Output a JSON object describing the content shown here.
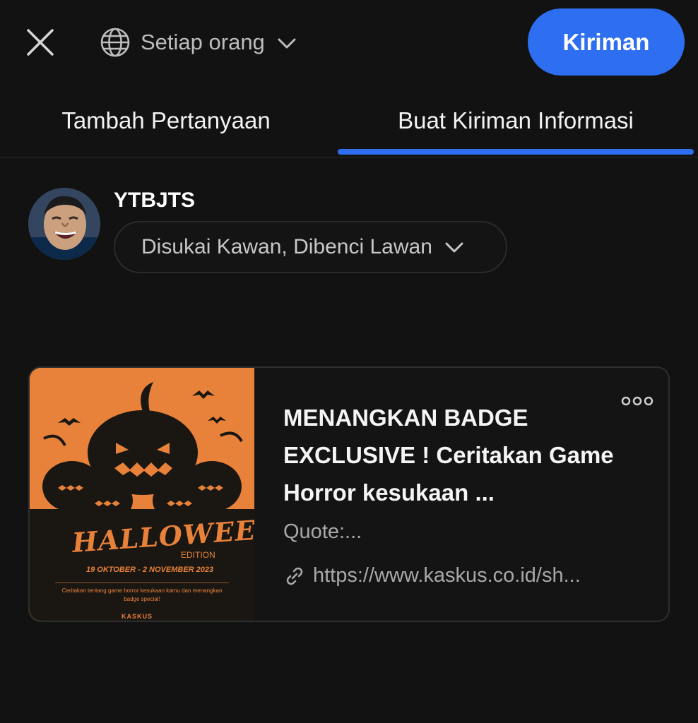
{
  "header": {
    "close_icon": "close-icon",
    "audience_icon": "globe-icon",
    "audience_label": "Setiap orang",
    "post_button_label": "Kiriman"
  },
  "tabs": [
    {
      "label": "Tambah Pertanyaan",
      "active": false
    },
    {
      "label": "Buat Kiriman Informasi",
      "active": true
    }
  ],
  "author": {
    "username": "YTBJTS",
    "space_label": "Disukai Kawan, Dibenci Lawan"
  },
  "link_card": {
    "title": "MENANGKAN BADGE EXCLUSIVE ! Ceritakan Game Horror kesukaan ...",
    "snippet": "Quote:...",
    "url": "https://www.kaskus.co.id/sh...",
    "more_icon": "more-options-icon",
    "thumbnail": {
      "title": "HALLOWEEN",
      "edition": "EDITION",
      "dates": "19 OKTOBER - 2 NOVEMBER 2023",
      "description": "Ceritakan tentang game horror kesukaan kamu dan menangkan badge special!",
      "brand": "KASKUS"
    }
  },
  "colors": {
    "accent": "#2e6ff2",
    "background": "#121212",
    "thumbnail_orange": "#e8823a"
  }
}
